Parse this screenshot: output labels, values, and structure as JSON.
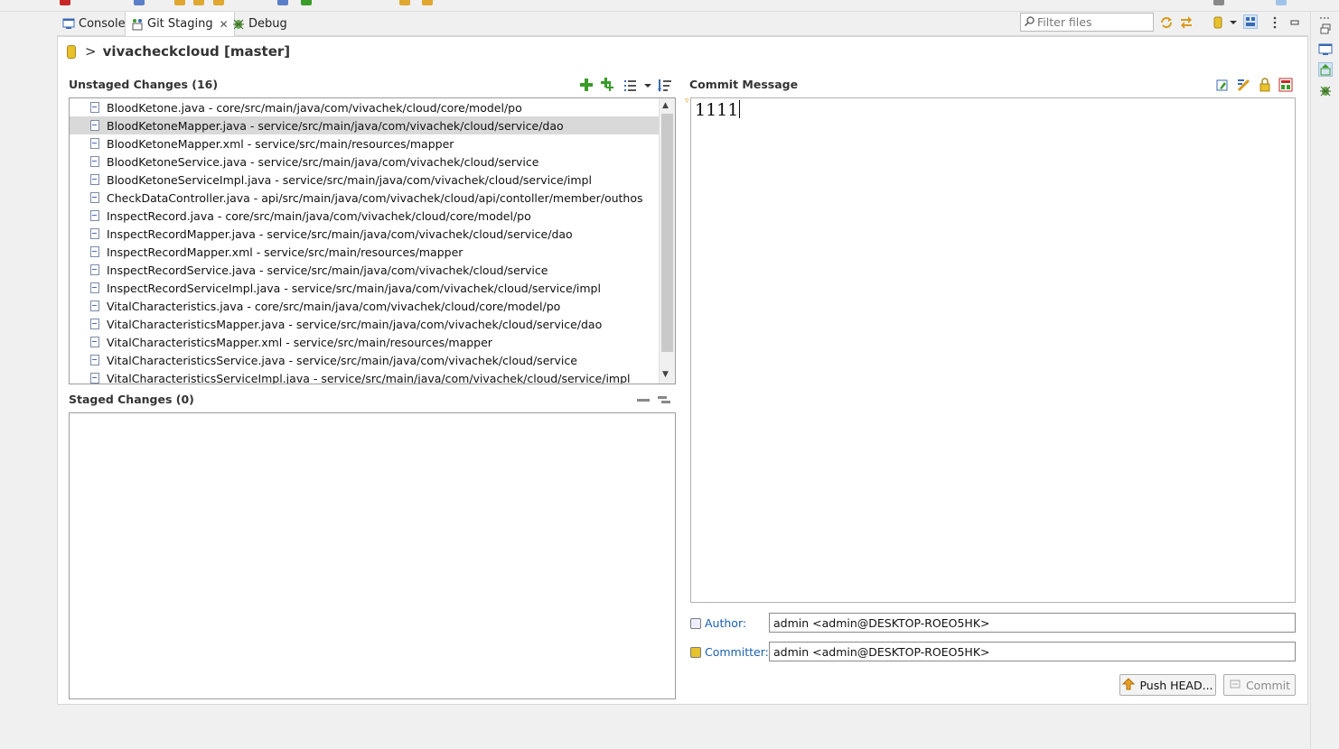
{
  "tabs": [
    {
      "label": "Console",
      "icon": "console-icon",
      "active": false
    },
    {
      "label": "Git Staging",
      "icon": "git-staging-icon",
      "active": true,
      "closable": true
    },
    {
      "label": "Debug",
      "icon": "debug-icon",
      "active": false
    }
  ],
  "filter": {
    "placeholder": "Filter files"
  },
  "repository": {
    "title": "vivacheckcloud [master]",
    "arrow": ">"
  },
  "unstaged": {
    "title": "Unstaged Changes (16)",
    "selected_index": 1,
    "files": [
      "BloodKetone.java - core/src/main/java/com/vivachek/cloud/core/model/po",
      "BloodKetoneMapper.java - service/src/main/java/com/vivachek/cloud/service/dao",
      "BloodKetoneMapper.xml - service/src/main/resources/mapper",
      "BloodKetoneService.java - service/src/main/java/com/vivachek/cloud/service",
      "BloodKetoneServiceImpl.java - service/src/main/java/com/vivachek/cloud/service/impl",
      "CheckDataController.java - api/src/main/java/com/vivachek/cloud/api/contoller/member/outhos",
      "InspectRecord.java - core/src/main/java/com/vivachek/cloud/core/model/po",
      "InspectRecordMapper.java - service/src/main/java/com/vivachek/cloud/service/dao",
      "InspectRecordMapper.xml - service/src/main/resources/mapper",
      "InspectRecordService.java - service/src/main/java/com/vivachek/cloud/service",
      "InspectRecordServiceImpl.java - service/src/main/java/com/vivachek/cloud/service/impl",
      "VitalCharacteristics.java - core/src/main/java/com/vivachek/cloud/core/model/po",
      "VitalCharacteristicsMapper.java - service/src/main/java/com/vivachek/cloud/service/dao",
      "VitalCharacteristicsMapper.xml - service/src/main/resources/mapper",
      "VitalCharacteristicsService.java - service/src/main/java/com/vivachek/cloud/service",
      "VitalCharacteristicsServiceImpl.java - service/src/main/java/com/vivachek/cloud/service/impl"
    ]
  },
  "staged": {
    "title": "Staged Changes (0)",
    "files": []
  },
  "commit": {
    "title": "Commit Message",
    "message": "1111",
    "author_label": "Author:",
    "author_value": "admin <admin@DESKTOP-ROEO5HK>",
    "committer_label": "Committer:",
    "committer_value": "admin <admin@DESKTOP-ROEO5HK>",
    "push_label": "Push HEAD...",
    "commit_label": "Commit"
  },
  "colors": {
    "accent_link": "#1a5fb4",
    "selection": "#d9d9d9",
    "add_icon": "#3a9b2a"
  }
}
